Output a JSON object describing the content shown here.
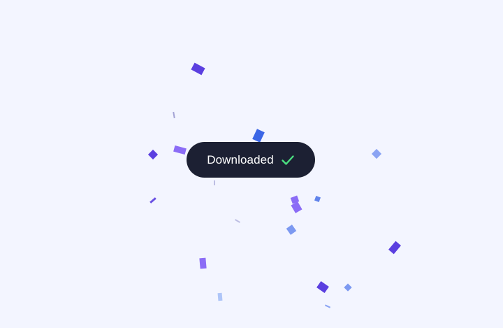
{
  "toast": {
    "label": "Downloaded",
    "icon": "check-icon",
    "icon_color": "#4ade80"
  },
  "colors": {
    "background": "#f3f5ff",
    "toast_background": "#1c2033",
    "toast_text": "#ffffff",
    "confetti_palette": [
      "#5b3fe0",
      "#8b6cf6",
      "#3b66e6",
      "#6f8ff0",
      "#a6c0f7",
      "#9a9ad0"
    ]
  }
}
